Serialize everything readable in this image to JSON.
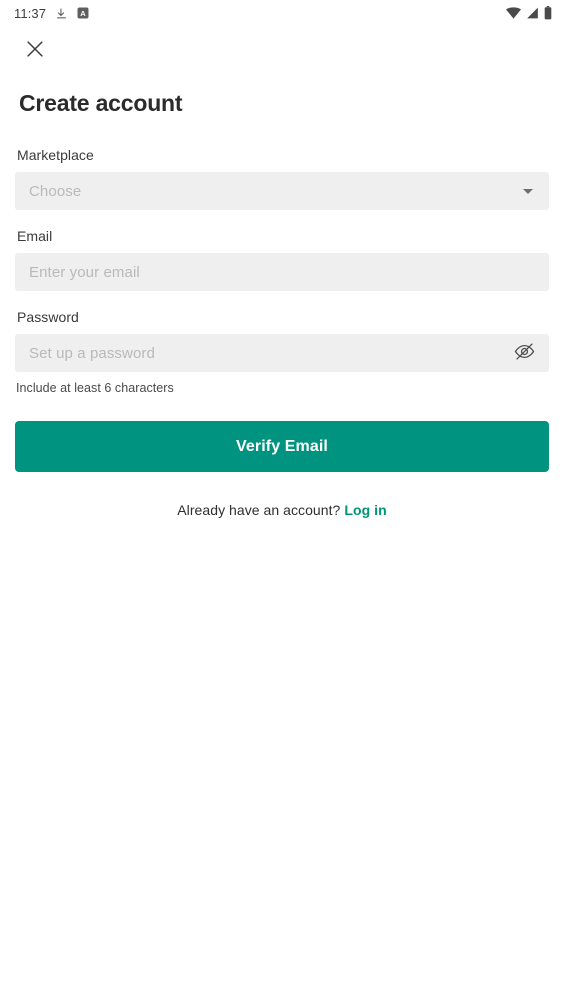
{
  "status_bar": {
    "time": "11:37",
    "left_icons": [
      "download-icon",
      "translate-app-icon"
    ],
    "right_icons": [
      "wifi-icon",
      "cellular-signal-icon",
      "battery-icon"
    ]
  },
  "top_bar": {
    "close_label": "Close"
  },
  "page": {
    "title": "Create account"
  },
  "form": {
    "marketplace": {
      "label": "Marketplace",
      "placeholder": "Choose",
      "value": "",
      "options": [
        "Choose"
      ]
    },
    "email": {
      "label": "Email",
      "placeholder": "Enter your email",
      "value": ""
    },
    "password": {
      "label": "Password",
      "placeholder": "Set up a password",
      "value": "",
      "helper": "Include at least 6 characters",
      "toggle_icon": "eye-off-icon"
    },
    "submit_label": "Verify Email"
  },
  "footer": {
    "prompt": "Already have an account?",
    "link_label": "Log in"
  },
  "colors": {
    "accent": "#009480",
    "link": "#009673",
    "field_bg": "#efefef",
    "text": "#2b2b2b",
    "placeholder": "#b9b9b9"
  }
}
